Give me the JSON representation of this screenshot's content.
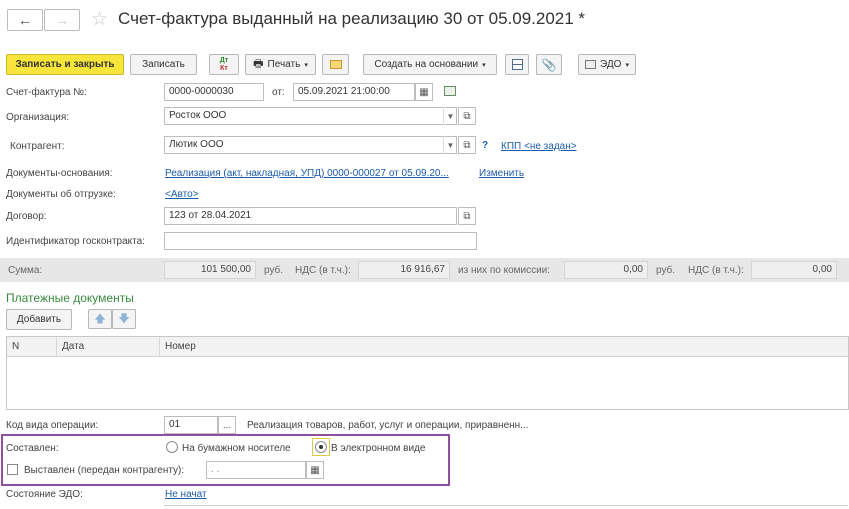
{
  "header": {
    "back_icon": "arrow-left-icon",
    "forward_icon": "arrow-right-icon",
    "favorite_icon": "star-icon",
    "title": "Счет-фактура выданный на реализацию 30 от 05.09.2021 *"
  },
  "toolbar": {
    "save_close": "Записать и закрыть",
    "save": "Записать",
    "dt_kt_top": "Дт",
    "dt_kt_bottom": "Кт",
    "print": "Печать",
    "create_based": "Создать на основании",
    "edo": "ЭДО"
  },
  "form": {
    "invoice_no_label": "Счет-фактура №:",
    "invoice_no": "0000-0000030",
    "from_label": "от:",
    "date": "05.09.2021 21:00:00",
    "org_label": "Организация:",
    "org": "Росток ООО",
    "contractor_label": "Контрагент:",
    "contractor": "Лютик ООО",
    "question": "?",
    "kpp_link": "КПП <не задан>",
    "base_docs_label": "Документы-основания:",
    "base_docs_link": "Реализация (акт, накладная, УПД) 0000-000027 от 05.09.20...",
    "change_link": "Изменить",
    "shipment_label": "Документы об отгрузке:",
    "shipment_link": "<Авто>",
    "contract_label": "Договор:",
    "contract": "123 от 28.04.2021",
    "gov_id_label": "Идентификатор госконтракта:",
    "gov_id": ""
  },
  "sums": {
    "sum_label": "Сумма:",
    "sum": "101 500,00",
    "rub1": "руб.",
    "vat_label": "НДС (в т.ч.):",
    "vat": "16 916,67",
    "commission_label": "из них по комиссии:",
    "commission": "0,00",
    "rub2": "руб.",
    "vat2_label": "НДС (в т.ч.):",
    "vat2": "0,00"
  },
  "payments": {
    "title": "Платежные документы",
    "add_button": "Добавить",
    "columns": [
      "N",
      "Дата",
      "Номер"
    ]
  },
  "operation": {
    "label": "Код вида операции:",
    "code": "01",
    "ellipsis": "...",
    "description": "Реализация товаров, работ, услуг и операции, приравненн..."
  },
  "composed": {
    "label": "Составлен:",
    "paper": "На бумажном носителе",
    "electronic": "В электронном виде",
    "issued_label": "Выставлен (передан контрагенту):",
    "issued_date": " .  .    "
  },
  "edo_state": {
    "label": "Состояние ЭДО:",
    "value": "Не начат"
  }
}
